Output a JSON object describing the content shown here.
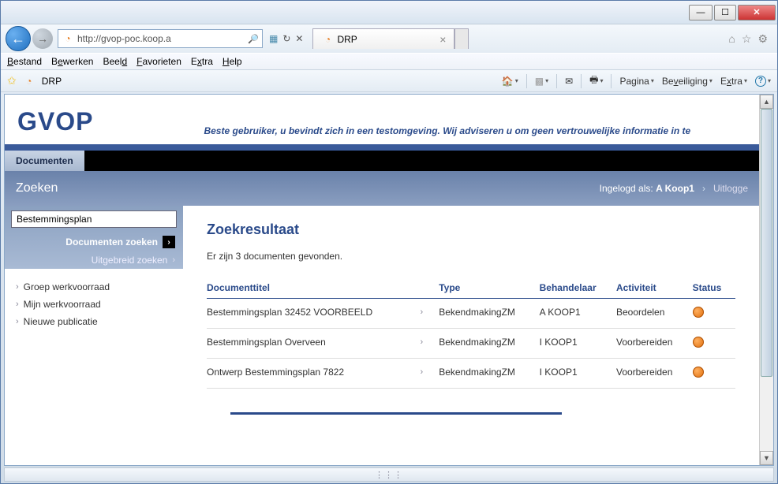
{
  "window": {
    "url": "http://gvop-poc.koop.a",
    "tab_title": "DRP",
    "favorite_label": "DRP"
  },
  "menubar": {
    "items": [
      "Bestand",
      "Bewerken",
      "Beeld",
      "Favorieten",
      "Extra",
      "Help"
    ]
  },
  "toolbar": {
    "pagina": "Pagina",
    "beveiliging": "Beveiliging",
    "extra": "Extra"
  },
  "page": {
    "logo": "GVOP",
    "banner": "Beste gebruiker, u bevindt zich in een testomgeving. Wij adviseren u om geen vertrouwelijke informatie in te",
    "tab_active": "Documenten",
    "subheader_title": "Zoeken",
    "logged_in_prefix": "Ingelogd als:",
    "logged_in_user": "A Koop1",
    "logout": "Uitlogge"
  },
  "sidebar": {
    "search_value": "Bestemmingsplan",
    "search_docs": "Documenten zoeken",
    "advanced": "Uitgebreid zoeken",
    "nav": [
      {
        "label": "Groep werkvoorraad"
      },
      {
        "label": "Mijn werkvoorraad"
      },
      {
        "label": "Nieuwe publicatie"
      }
    ]
  },
  "results": {
    "title": "Zoekresultaat",
    "count_text": "Er zijn 3 documenten gevonden.",
    "columns": {
      "title": "Documenttitel",
      "type": "Type",
      "handler": "Behandelaar",
      "activity": "Activiteit",
      "status": "Status"
    },
    "rows": [
      {
        "title": "Bestemmingsplan 32452 VOORBEELD",
        "type": "BekendmakingZM",
        "handler": "A KOOP1",
        "activity": "Beoordelen",
        "status": "orange"
      },
      {
        "title": "Bestemmingsplan Overveen",
        "type": "BekendmakingZM",
        "handler": "I KOOP1",
        "activity": "Voorbereiden",
        "status": "orange"
      },
      {
        "title": "Ontwerp Bestemmingsplan 7822",
        "type": "BekendmakingZM",
        "handler": "I KOOP1",
        "activity": "Voorbereiden",
        "status": "orange"
      }
    ]
  }
}
